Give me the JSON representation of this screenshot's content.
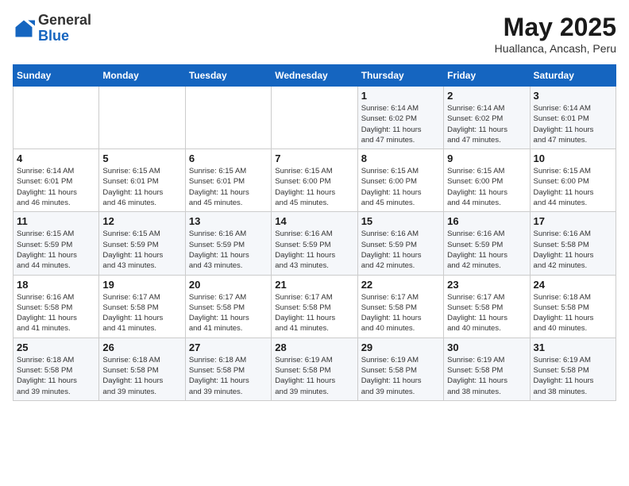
{
  "header": {
    "logo_line1": "General",
    "logo_line2": "Blue",
    "title": "May 2025",
    "subtitle": "Huallanca, Ancash, Peru"
  },
  "weekdays": [
    "Sunday",
    "Monday",
    "Tuesday",
    "Wednesday",
    "Thursday",
    "Friday",
    "Saturday"
  ],
  "weeks": [
    [
      {
        "day": "",
        "info": ""
      },
      {
        "day": "",
        "info": ""
      },
      {
        "day": "",
        "info": ""
      },
      {
        "day": "",
        "info": ""
      },
      {
        "day": "1",
        "info": "Sunrise: 6:14 AM\nSunset: 6:02 PM\nDaylight: 11 hours\nand 47 minutes."
      },
      {
        "day": "2",
        "info": "Sunrise: 6:14 AM\nSunset: 6:02 PM\nDaylight: 11 hours\nand 47 minutes."
      },
      {
        "day": "3",
        "info": "Sunrise: 6:14 AM\nSunset: 6:01 PM\nDaylight: 11 hours\nand 47 minutes."
      }
    ],
    [
      {
        "day": "4",
        "info": "Sunrise: 6:14 AM\nSunset: 6:01 PM\nDaylight: 11 hours\nand 46 minutes."
      },
      {
        "day": "5",
        "info": "Sunrise: 6:15 AM\nSunset: 6:01 PM\nDaylight: 11 hours\nand 46 minutes."
      },
      {
        "day": "6",
        "info": "Sunrise: 6:15 AM\nSunset: 6:01 PM\nDaylight: 11 hours\nand 45 minutes."
      },
      {
        "day": "7",
        "info": "Sunrise: 6:15 AM\nSunset: 6:00 PM\nDaylight: 11 hours\nand 45 minutes."
      },
      {
        "day": "8",
        "info": "Sunrise: 6:15 AM\nSunset: 6:00 PM\nDaylight: 11 hours\nand 45 minutes."
      },
      {
        "day": "9",
        "info": "Sunrise: 6:15 AM\nSunset: 6:00 PM\nDaylight: 11 hours\nand 44 minutes."
      },
      {
        "day": "10",
        "info": "Sunrise: 6:15 AM\nSunset: 6:00 PM\nDaylight: 11 hours\nand 44 minutes."
      }
    ],
    [
      {
        "day": "11",
        "info": "Sunrise: 6:15 AM\nSunset: 5:59 PM\nDaylight: 11 hours\nand 44 minutes."
      },
      {
        "day": "12",
        "info": "Sunrise: 6:15 AM\nSunset: 5:59 PM\nDaylight: 11 hours\nand 43 minutes."
      },
      {
        "day": "13",
        "info": "Sunrise: 6:16 AM\nSunset: 5:59 PM\nDaylight: 11 hours\nand 43 minutes."
      },
      {
        "day": "14",
        "info": "Sunrise: 6:16 AM\nSunset: 5:59 PM\nDaylight: 11 hours\nand 43 minutes."
      },
      {
        "day": "15",
        "info": "Sunrise: 6:16 AM\nSunset: 5:59 PM\nDaylight: 11 hours\nand 42 minutes."
      },
      {
        "day": "16",
        "info": "Sunrise: 6:16 AM\nSunset: 5:59 PM\nDaylight: 11 hours\nand 42 minutes."
      },
      {
        "day": "17",
        "info": "Sunrise: 6:16 AM\nSunset: 5:58 PM\nDaylight: 11 hours\nand 42 minutes."
      }
    ],
    [
      {
        "day": "18",
        "info": "Sunrise: 6:16 AM\nSunset: 5:58 PM\nDaylight: 11 hours\nand 41 minutes."
      },
      {
        "day": "19",
        "info": "Sunrise: 6:17 AM\nSunset: 5:58 PM\nDaylight: 11 hours\nand 41 minutes."
      },
      {
        "day": "20",
        "info": "Sunrise: 6:17 AM\nSunset: 5:58 PM\nDaylight: 11 hours\nand 41 minutes."
      },
      {
        "day": "21",
        "info": "Sunrise: 6:17 AM\nSunset: 5:58 PM\nDaylight: 11 hours\nand 41 minutes."
      },
      {
        "day": "22",
        "info": "Sunrise: 6:17 AM\nSunset: 5:58 PM\nDaylight: 11 hours\nand 40 minutes."
      },
      {
        "day": "23",
        "info": "Sunrise: 6:17 AM\nSunset: 5:58 PM\nDaylight: 11 hours\nand 40 minutes."
      },
      {
        "day": "24",
        "info": "Sunrise: 6:18 AM\nSunset: 5:58 PM\nDaylight: 11 hours\nand 40 minutes."
      }
    ],
    [
      {
        "day": "25",
        "info": "Sunrise: 6:18 AM\nSunset: 5:58 PM\nDaylight: 11 hours\nand 39 minutes."
      },
      {
        "day": "26",
        "info": "Sunrise: 6:18 AM\nSunset: 5:58 PM\nDaylight: 11 hours\nand 39 minutes."
      },
      {
        "day": "27",
        "info": "Sunrise: 6:18 AM\nSunset: 5:58 PM\nDaylight: 11 hours\nand 39 minutes."
      },
      {
        "day": "28",
        "info": "Sunrise: 6:19 AM\nSunset: 5:58 PM\nDaylight: 11 hours\nand 39 minutes."
      },
      {
        "day": "29",
        "info": "Sunrise: 6:19 AM\nSunset: 5:58 PM\nDaylight: 11 hours\nand 39 minutes."
      },
      {
        "day": "30",
        "info": "Sunrise: 6:19 AM\nSunset: 5:58 PM\nDaylight: 11 hours\nand 38 minutes."
      },
      {
        "day": "31",
        "info": "Sunrise: 6:19 AM\nSunset: 5:58 PM\nDaylight: 11 hours\nand 38 minutes."
      }
    ]
  ]
}
